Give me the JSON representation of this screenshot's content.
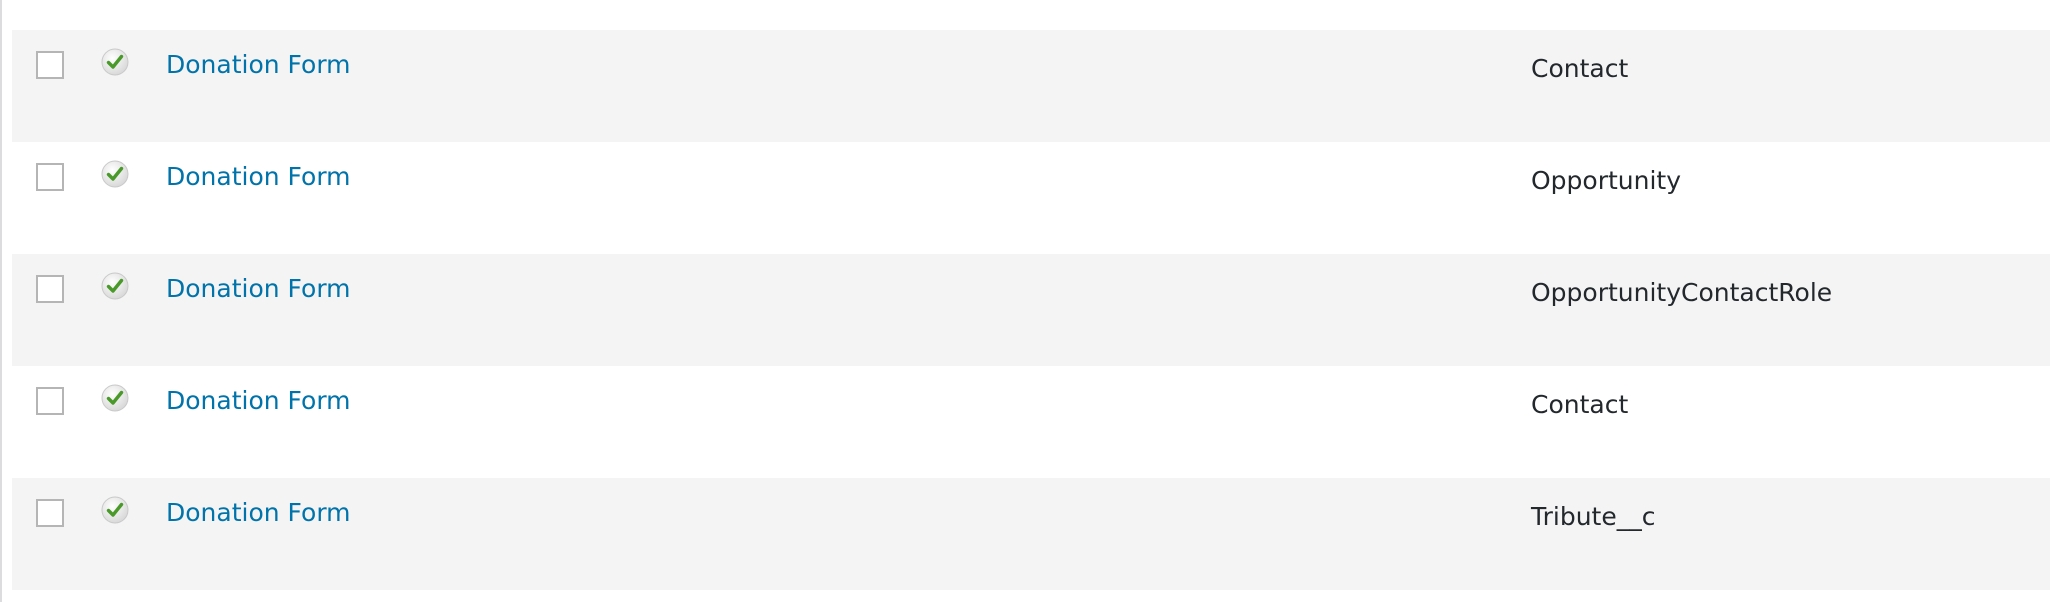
{
  "icons": {
    "status": "check-circle-icon",
    "status_color": "#4a9a2a"
  },
  "colors": {
    "link": "#0073aa",
    "row_alt": "#f4f4f4",
    "text": "#23282d"
  },
  "rows": [
    {
      "title": "Donation Form",
      "object": "Contact"
    },
    {
      "title": "Donation Form",
      "object": "Opportunity"
    },
    {
      "title": "Donation Form",
      "object": "OpportunityContactRole"
    },
    {
      "title": "Donation Form",
      "object": "Contact"
    },
    {
      "title": "Donation Form",
      "object": "Tribute__c"
    }
  ]
}
